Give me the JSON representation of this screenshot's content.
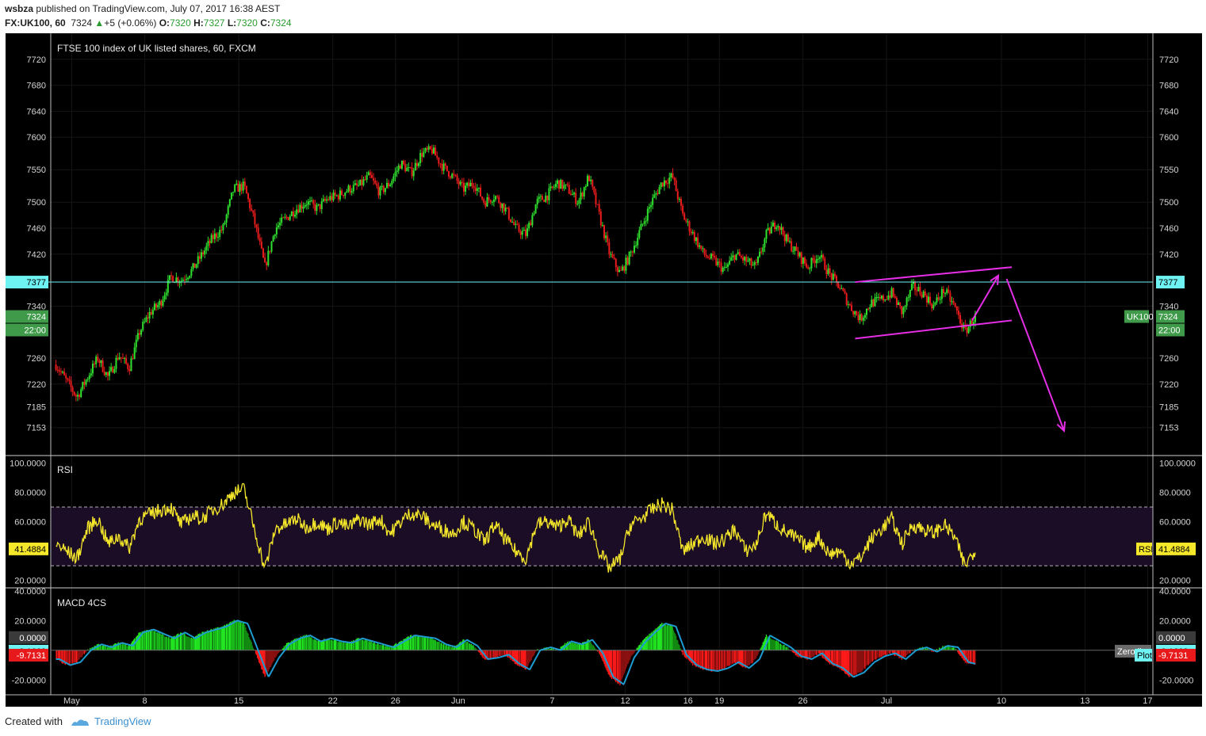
{
  "header": {
    "author": "wsbza",
    "published_text": " published on TradingView.com, July 07, 2017 16:38 AEST",
    "symbol": "FX:UK100, 60",
    "last": "7324",
    "change": "+5 (+0.06%)",
    "o_label": "O:",
    "o": "7320",
    "h_label": "H:",
    "h": "7327",
    "l_label": "L:",
    "l": "7320",
    "c_label": "C:",
    "c": "7324"
  },
  "footer": {
    "created_with": "Created with",
    "brand": "TradingView"
  },
  "colors": {
    "up": "#2fe02f",
    "down": "#e81c1c",
    "rsi": "#f5e72a",
    "rsi_band": "#1c0d26",
    "signal": "#1e9bd0",
    "level": "#6ff2f2",
    "drawing": "#e52ee5"
  },
  "chart_data": [
    {
      "type": "candlestick",
      "title": "FTSE 100 index of UK listed shares, 60, FXCM",
      "ylim": [
        7110,
        7760
      ],
      "y_ticks": [
        "7720",
        "7680",
        "7640",
        "7600",
        "7550",
        "7500",
        "7460",
        "7420",
        "7340",
        "7260",
        "7220",
        "7185",
        "7153"
      ],
      "x_ticks": [
        {
          "label": "May",
          "x": 0.5
        },
        {
          "label": "8",
          "x": 7.5
        },
        {
          "label": "15",
          "x": 16.5
        },
        {
          "label": "22",
          "x": 25.5
        },
        {
          "label": "26",
          "x": 31.5
        },
        {
          "label": "Jun",
          "x": 37.5
        },
        {
          "label": "7",
          "x": 46.5
        },
        {
          "label": "12",
          "x": 53.5
        },
        {
          "label": "16",
          "x": 59.5
        },
        {
          "label": "19",
          "x": 62.5
        },
        {
          "label": "26",
          "x": 70.5
        },
        {
          "label": "Jul",
          "x": 78.5
        },
        {
          "label": "10",
          "x": 89.5
        },
        {
          "label": "13",
          "x": 97.5
        },
        {
          "label": "17",
          "x": 103.5
        }
      ],
      "xlim": [
        -1.5,
        104
      ],
      "anchors": [
        [
          -1,
          7250
        ],
        [
          0,
          7225
        ],
        [
          1,
          7200
        ],
        [
          2,
          7230
        ],
        [
          3,
          7260
        ],
        [
          4,
          7230
        ],
        [
          5,
          7265
        ],
        [
          6,
          7245
        ],
        [
          7,
          7300
        ],
        [
          8,
          7330
        ],
        [
          9,
          7345
        ],
        [
          10,
          7385
        ],
        [
          11,
          7380
        ],
        [
          12,
          7395
        ],
        [
          13,
          7420
        ],
        [
          14,
          7445
        ],
        [
          15,
          7460
        ],
        [
          16,
          7520
        ],
        [
          17,
          7525
        ],
        [
          18,
          7470
        ],
        [
          19,
          7400
        ],
        [
          20,
          7460
        ],
        [
          21,
          7475
        ],
        [
          22,
          7490
        ],
        [
          23,
          7500
        ],
        [
          24,
          7490
        ],
        [
          25,
          7505
        ],
        [
          26,
          7510
        ],
        [
          27,
          7520
        ],
        [
          28,
          7525
        ],
        [
          29,
          7540
        ],
        [
          30,
          7515
        ],
        [
          31,
          7530
        ],
        [
          32,
          7560
        ],
        [
          33,
          7545
        ],
        [
          34,
          7575
        ],
        [
          35,
          7580
        ],
        [
          36,
          7555
        ],
        [
          37,
          7540
        ],
        [
          38,
          7520
        ],
        [
          39,
          7530
        ],
        [
          40,
          7500
        ],
        [
          41,
          7510
        ],
        [
          42,
          7490
        ],
        [
          43,
          7460
        ],
        [
          44,
          7450
        ],
        [
          45,
          7500
        ],
        [
          46,
          7510
        ],
        [
          47,
          7530
        ],
        [
          48,
          7520
        ],
        [
          49,
          7500
        ],
        [
          50,
          7540
        ],
        [
          51,
          7480
        ],
        [
          52,
          7420
        ],
        [
          53,
          7390
        ],
        [
          54,
          7420
        ],
        [
          55,
          7460
        ],
        [
          56,
          7500
        ],
        [
          57,
          7530
        ],
        [
          58,
          7540
        ],
        [
          59,
          7480
        ],
        [
          60,
          7450
        ],
        [
          61,
          7420
        ],
        [
          62,
          7410
        ],
        [
          63,
          7395
        ],
        [
          64,
          7420
        ],
        [
          65,
          7410
        ],
        [
          66,
          7400
        ],
        [
          67,
          7450
        ],
        [
          68,
          7470
        ],
        [
          69,
          7440
        ],
        [
          70,
          7420
        ],
        [
          71,
          7400
        ],
        [
          72,
          7420
        ],
        [
          73,
          7390
        ],
        [
          74,
          7370
        ],
        [
          75,
          7340
        ],
        [
          76,
          7320
        ],
        [
          77,
          7345
        ],
        [
          78,
          7350
        ],
        [
          79,
          7360
        ],
        [
          80,
          7330
        ],
        [
          81,
          7370
        ],
        [
          82,
          7360
        ],
        [
          83,
          7340
        ],
        [
          84,
          7365
        ],
        [
          85,
          7340
        ],
        [
          86,
          7300
        ],
        [
          87,
          7324
        ]
      ],
      "last_price": "7324",
      "level_value": 7377,
      "level_label": "7377",
      "last_time": "22:00",
      "symbol_tag": "UK100",
      "channel_upper": [
        [
          75.5,
          7377
        ],
        [
          90.5,
          7400
        ]
      ],
      "channel_lower": [
        [
          75.5,
          7290
        ],
        [
          90.5,
          7318
        ]
      ],
      "arrow_up": [
        [
          86.7,
          7318
        ],
        [
          89.2,
          7387
        ]
      ],
      "arrow_down": [
        [
          90,
          7382
        ],
        [
          95.5,
          7148
        ]
      ]
    },
    {
      "type": "line",
      "title": "RSI",
      "ylim": [
        15,
        105
      ],
      "y_ticks": [
        "100.0000",
        "80.0000",
        "60.0000",
        "20.0000"
      ],
      "upper_band": 70,
      "lower_band": 30,
      "anchors": [
        [
          -1,
          45
        ],
        [
          0,
          40
        ],
        [
          1,
          35
        ],
        [
          2,
          55
        ],
        [
          3,
          62
        ],
        [
          4,
          45
        ],
        [
          5,
          50
        ],
        [
          6,
          42
        ],
        [
          7,
          62
        ],
        [
          8,
          65
        ],
        [
          9,
          68
        ],
        [
          10,
          70
        ],
        [
          11,
          58
        ],
        [
          12,
          64
        ],
        [
          13,
          62
        ],
        [
          14,
          68
        ],
        [
          15,
          72
        ],
        [
          16,
          80
        ],
        [
          17,
          82
        ],
        [
          18,
          55
        ],
        [
          19,
          28
        ],
        [
          20,
          55
        ],
        [
          21,
          58
        ],
        [
          22,
          62
        ],
        [
          23,
          56
        ],
        [
          24,
          60
        ],
        [
          25,
          55
        ],
        [
          26,
          60
        ],
        [
          27,
          56
        ],
        [
          28,
          62
        ],
        [
          29,
          58
        ],
        [
          30,
          62
        ],
        [
          31,
          52
        ],
        [
          32,
          60
        ],
        [
          33,
          66
        ],
        [
          34,
          64
        ],
        [
          35,
          58
        ],
        [
          36,
          55
        ],
        [
          37,
          52
        ],
        [
          38,
          60
        ],
        [
          39,
          55
        ],
        [
          40,
          46
        ],
        [
          41,
          58
        ],
        [
          42,
          48
        ],
        [
          43,
          40
        ],
        [
          44,
          35
        ],
        [
          45,
          58
        ],
        [
          46,
          60
        ],
        [
          47,
          56
        ],
        [
          48,
          62
        ],
        [
          49,
          50
        ],
        [
          50,
          60
        ],
        [
          51,
          40
        ],
        [
          52,
          28
        ],
        [
          53,
          35
        ],
        [
          54,
          58
        ],
        [
          55,
          62
        ],
        [
          56,
          68
        ],
        [
          57,
          72
        ],
        [
          58,
          68
        ],
        [
          59,
          40
        ],
        [
          60,
          45
        ],
        [
          61,
          50
        ],
        [
          62,
          45
        ],
        [
          63,
          48
        ],
        [
          64,
          55
        ],
        [
          65,
          40
        ],
        [
          66,
          44
        ],
        [
          67,
          66
        ],
        [
          68,
          58
        ],
        [
          69,
          52
        ],
        [
          70,
          48
        ],
        [
          71,
          42
        ],
        [
          72,
          50
        ],
        [
          73,
          38
        ],
        [
          74,
          40
        ],
        [
          75,
          32
        ],
        [
          76,
          35
        ],
        [
          77,
          48
        ],
        [
          78,
          55
        ],
        [
          79,
          62
        ],
        [
          80,
          45
        ],
        [
          81,
          58
        ],
        [
          82,
          55
        ],
        [
          83,
          52
        ],
        [
          84,
          58
        ],
        [
          85,
          50
        ],
        [
          86,
          30
        ],
        [
          87,
          41.4884
        ]
      ],
      "last_value": "41.4884",
      "legend": "RSI"
    },
    {
      "type": "histogram",
      "title": "MACD 4CS",
      "ylim": [
        -30,
        42
      ],
      "y_ticks": [
        "40.0000",
        "20.0000",
        "0.0000",
        "-20.0000"
      ],
      "anchors": [
        [
          -1,
          -6
        ],
        [
          0,
          -10
        ],
        [
          1,
          -8
        ],
        [
          2,
          0
        ],
        [
          3,
          4
        ],
        [
          4,
          2
        ],
        [
          5,
          5
        ],
        [
          6,
          3
        ],
        [
          7,
          12
        ],
        [
          8,
          14
        ],
        [
          9,
          11
        ],
        [
          10,
          8
        ],
        [
          11,
          12
        ],
        [
          12,
          8
        ],
        [
          13,
          12
        ],
        [
          14,
          14
        ],
        [
          15,
          16
        ],
        [
          16,
          20
        ],
        [
          17,
          18
        ],
        [
          18,
          0
        ],
        [
          19,
          -18
        ],
        [
          20,
          -5
        ],
        [
          21,
          4
        ],
        [
          22,
          8
        ],
        [
          23,
          10
        ],
        [
          24,
          6
        ],
        [
          25,
          8
        ],
        [
          26,
          6
        ],
        [
          27,
          5
        ],
        [
          28,
          8
        ],
        [
          29,
          6
        ],
        [
          30,
          4
        ],
        [
          31,
          2
        ],
        [
          32,
          6
        ],
        [
          33,
          10
        ],
        [
          34,
          9
        ],
        [
          35,
          8
        ],
        [
          36,
          4
        ],
        [
          37,
          2
        ],
        [
          38,
          7
        ],
        [
          39,
          3
        ],
        [
          40,
          -6
        ],
        [
          41,
          -5
        ],
        [
          42,
          -3
        ],
        [
          43,
          -9
        ],
        [
          44,
          -13
        ],
        [
          45,
          0
        ],
        [
          46,
          2
        ],
        [
          47,
          0
        ],
        [
          48,
          6
        ],
        [
          49,
          4
        ],
        [
          50,
          7
        ],
        [
          51,
          -2
        ],
        [
          52,
          -18
        ],
        [
          53,
          -23
        ],
        [
          54,
          -5
        ],
        [
          55,
          5
        ],
        [
          56,
          12
        ],
        [
          57,
          18
        ],
        [
          58,
          16
        ],
        [
          59,
          -3
        ],
        [
          60,
          -10
        ],
        [
          61,
          -13
        ],
        [
          62,
          -14
        ],
        [
          63,
          -12
        ],
        [
          64,
          -8
        ],
        [
          65,
          -12
        ],
        [
          66,
          -6
        ],
        [
          67,
          10
        ],
        [
          68,
          6
        ],
        [
          69,
          2
        ],
        [
          70,
          -4
        ],
        [
          71,
          -6
        ],
        [
          72,
          -2
        ],
        [
          73,
          -9
        ],
        [
          74,
          -12
        ],
        [
          75,
          -18
        ],
        [
          76,
          -15
        ],
        [
          77,
          -8
        ],
        [
          78,
          -4
        ],
        [
          79,
          -2
        ],
        [
          80,
          -6
        ],
        [
          81,
          0
        ],
        [
          82,
          2
        ],
        [
          83,
          -1
        ],
        [
          84,
          3
        ],
        [
          85,
          2
        ],
        [
          86,
          -8
        ],
        [
          87,
          -9.7131
        ]
      ],
      "macd_value": "-9.1663",
      "hist_value": "-9.7131",
      "zero_value": "0.0000",
      "zero_label": "Zero line",
      "plot_label": "Plot"
    }
  ]
}
